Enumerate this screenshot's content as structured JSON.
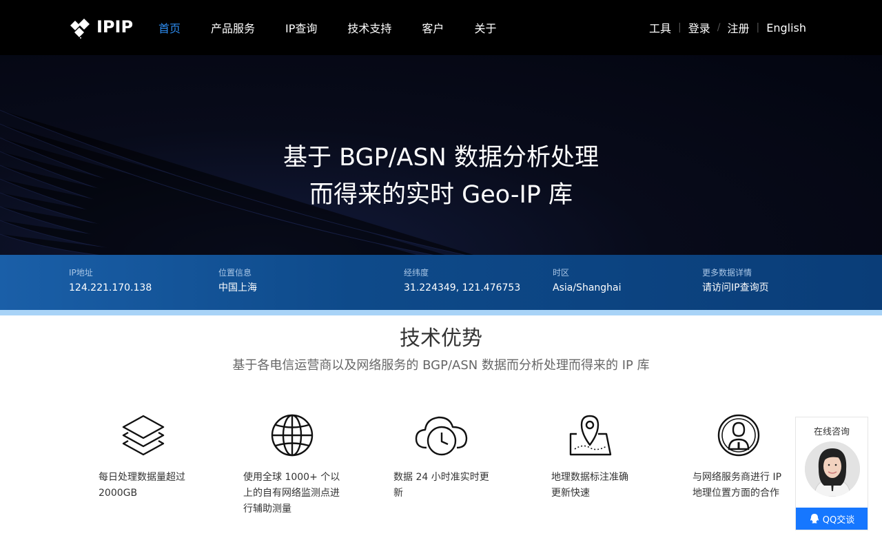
{
  "brand": {
    "name": "IPIP"
  },
  "nav": {
    "links": [
      "首页",
      "产品服务",
      "IP查询",
      "技术支持",
      "客户",
      "关于"
    ],
    "active_index": 0,
    "right": {
      "tools": "工具",
      "login": "登录",
      "register": "注册",
      "english": "English",
      "sep1": "|",
      "sep2": "/",
      "sep3": "|"
    }
  },
  "hero": {
    "line1": "基于 BGP/ASN 数据分析处理",
    "line2": "而得来的实时 Geo-IP 库"
  },
  "infobar": {
    "ip": {
      "label": "IP地址",
      "value": "124.221.170.138"
    },
    "location": {
      "label": "位置信息",
      "value": "中国上海"
    },
    "coords": {
      "label": "经纬度",
      "value": "31.224349, 121.476753"
    },
    "timezone": {
      "label": "时区",
      "value": "Asia/Shanghai"
    },
    "more": {
      "label": "更多数据详情",
      "value": "请访问IP查询页"
    }
  },
  "tech": {
    "title": "技术优势",
    "subtitle": "基于各电信运营商以及网络服务的 BGP/ASN 数据而分析处理而得来的 IP 库",
    "features": [
      {
        "icon": "layers-icon",
        "lines": [
          "每日处理数据量超过",
          "2000GB"
        ]
      },
      {
        "icon": "globe-icon",
        "lines": [
          "使用全球 1000+ 个以",
          "上的自有网络监测点进",
          "行辅助测量"
        ]
      },
      {
        "icon": "cloud-clock-icon",
        "lines": [
          "数据 24 小时准实时更",
          "新"
        ]
      },
      {
        "icon": "map-pin-icon",
        "lines": [
          "地理数据标注准确",
          "更新快速"
        ]
      },
      {
        "icon": "person-circle-icon",
        "lines": [
          "与网络服务商进行 IP",
          "地理位置方面的合作"
        ]
      }
    ]
  },
  "consult": {
    "title": "在线咨询",
    "button": "QQ交谈"
  },
  "colors": {
    "accent": "#2d8cf0",
    "infobar": "#0e4a8a",
    "qq_button": "#1677ff"
  }
}
